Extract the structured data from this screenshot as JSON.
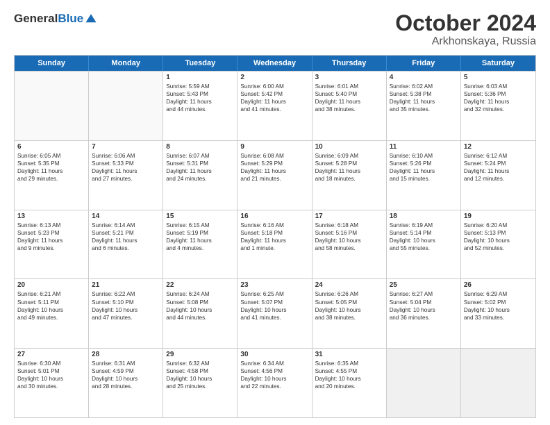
{
  "header": {
    "logo_general": "General",
    "logo_blue": "Blue",
    "month_title": "October 2024",
    "location": "Arkhonskaya, Russia"
  },
  "days_of_week": [
    "Sunday",
    "Monday",
    "Tuesday",
    "Wednesday",
    "Thursday",
    "Friday",
    "Saturday"
  ],
  "weeks": [
    [
      {
        "day": "",
        "lines": [],
        "empty": true
      },
      {
        "day": "",
        "lines": [],
        "empty": true
      },
      {
        "day": "1",
        "lines": [
          "Sunrise: 5:59 AM",
          "Sunset: 5:43 PM",
          "Daylight: 11 hours",
          "and 44 minutes."
        ]
      },
      {
        "day": "2",
        "lines": [
          "Sunrise: 6:00 AM",
          "Sunset: 5:42 PM",
          "Daylight: 11 hours",
          "and 41 minutes."
        ]
      },
      {
        "day": "3",
        "lines": [
          "Sunrise: 6:01 AM",
          "Sunset: 5:40 PM",
          "Daylight: 11 hours",
          "and 38 minutes."
        ]
      },
      {
        "day": "4",
        "lines": [
          "Sunrise: 6:02 AM",
          "Sunset: 5:38 PM",
          "Daylight: 11 hours",
          "and 35 minutes."
        ]
      },
      {
        "day": "5",
        "lines": [
          "Sunrise: 6:03 AM",
          "Sunset: 5:36 PM",
          "Daylight: 11 hours",
          "and 32 minutes."
        ]
      }
    ],
    [
      {
        "day": "6",
        "lines": [
          "Sunrise: 6:05 AM",
          "Sunset: 5:35 PM",
          "Daylight: 11 hours",
          "and 29 minutes."
        ]
      },
      {
        "day": "7",
        "lines": [
          "Sunrise: 6:06 AM",
          "Sunset: 5:33 PM",
          "Daylight: 11 hours",
          "and 27 minutes."
        ]
      },
      {
        "day": "8",
        "lines": [
          "Sunrise: 6:07 AM",
          "Sunset: 5:31 PM",
          "Daylight: 11 hours",
          "and 24 minutes."
        ]
      },
      {
        "day": "9",
        "lines": [
          "Sunrise: 6:08 AM",
          "Sunset: 5:29 PM",
          "Daylight: 11 hours",
          "and 21 minutes."
        ]
      },
      {
        "day": "10",
        "lines": [
          "Sunrise: 6:09 AM",
          "Sunset: 5:28 PM",
          "Daylight: 11 hours",
          "and 18 minutes."
        ]
      },
      {
        "day": "11",
        "lines": [
          "Sunrise: 6:10 AM",
          "Sunset: 5:26 PM",
          "Daylight: 11 hours",
          "and 15 minutes."
        ]
      },
      {
        "day": "12",
        "lines": [
          "Sunrise: 6:12 AM",
          "Sunset: 5:24 PM",
          "Daylight: 11 hours",
          "and 12 minutes."
        ]
      }
    ],
    [
      {
        "day": "13",
        "lines": [
          "Sunrise: 6:13 AM",
          "Sunset: 5:23 PM",
          "Daylight: 11 hours",
          "and 9 minutes."
        ]
      },
      {
        "day": "14",
        "lines": [
          "Sunrise: 6:14 AM",
          "Sunset: 5:21 PM",
          "Daylight: 11 hours",
          "and 6 minutes."
        ]
      },
      {
        "day": "15",
        "lines": [
          "Sunrise: 6:15 AM",
          "Sunset: 5:19 PM",
          "Daylight: 11 hours",
          "and 4 minutes."
        ]
      },
      {
        "day": "16",
        "lines": [
          "Sunrise: 6:16 AM",
          "Sunset: 5:18 PM",
          "Daylight: 11 hours",
          "and 1 minute."
        ]
      },
      {
        "day": "17",
        "lines": [
          "Sunrise: 6:18 AM",
          "Sunset: 5:16 PM",
          "Daylight: 10 hours",
          "and 58 minutes."
        ]
      },
      {
        "day": "18",
        "lines": [
          "Sunrise: 6:19 AM",
          "Sunset: 5:14 PM",
          "Daylight: 10 hours",
          "and 55 minutes."
        ]
      },
      {
        "day": "19",
        "lines": [
          "Sunrise: 6:20 AM",
          "Sunset: 5:13 PM",
          "Daylight: 10 hours",
          "and 52 minutes."
        ]
      }
    ],
    [
      {
        "day": "20",
        "lines": [
          "Sunrise: 6:21 AM",
          "Sunset: 5:11 PM",
          "Daylight: 10 hours",
          "and 49 minutes."
        ]
      },
      {
        "day": "21",
        "lines": [
          "Sunrise: 6:22 AM",
          "Sunset: 5:10 PM",
          "Daylight: 10 hours",
          "and 47 minutes."
        ]
      },
      {
        "day": "22",
        "lines": [
          "Sunrise: 6:24 AM",
          "Sunset: 5:08 PM",
          "Daylight: 10 hours",
          "and 44 minutes."
        ]
      },
      {
        "day": "23",
        "lines": [
          "Sunrise: 6:25 AM",
          "Sunset: 5:07 PM",
          "Daylight: 10 hours",
          "and 41 minutes."
        ]
      },
      {
        "day": "24",
        "lines": [
          "Sunrise: 6:26 AM",
          "Sunset: 5:05 PM",
          "Daylight: 10 hours",
          "and 38 minutes."
        ]
      },
      {
        "day": "25",
        "lines": [
          "Sunrise: 6:27 AM",
          "Sunset: 5:04 PM",
          "Daylight: 10 hours",
          "and 36 minutes."
        ]
      },
      {
        "day": "26",
        "lines": [
          "Sunrise: 6:29 AM",
          "Sunset: 5:02 PM",
          "Daylight: 10 hours",
          "and 33 minutes."
        ]
      }
    ],
    [
      {
        "day": "27",
        "lines": [
          "Sunrise: 6:30 AM",
          "Sunset: 5:01 PM",
          "Daylight: 10 hours",
          "and 30 minutes."
        ]
      },
      {
        "day": "28",
        "lines": [
          "Sunrise: 6:31 AM",
          "Sunset: 4:59 PM",
          "Daylight: 10 hours",
          "and 28 minutes."
        ]
      },
      {
        "day": "29",
        "lines": [
          "Sunrise: 6:32 AM",
          "Sunset: 4:58 PM",
          "Daylight: 10 hours",
          "and 25 minutes."
        ]
      },
      {
        "day": "30",
        "lines": [
          "Sunrise: 6:34 AM",
          "Sunset: 4:56 PM",
          "Daylight: 10 hours",
          "and 22 minutes."
        ]
      },
      {
        "day": "31",
        "lines": [
          "Sunrise: 6:35 AM",
          "Sunset: 4:55 PM",
          "Daylight: 10 hours",
          "and 20 minutes."
        ]
      },
      {
        "day": "",
        "lines": [],
        "empty": true,
        "shaded": true
      },
      {
        "day": "",
        "lines": [],
        "empty": true,
        "shaded": true
      }
    ]
  ]
}
